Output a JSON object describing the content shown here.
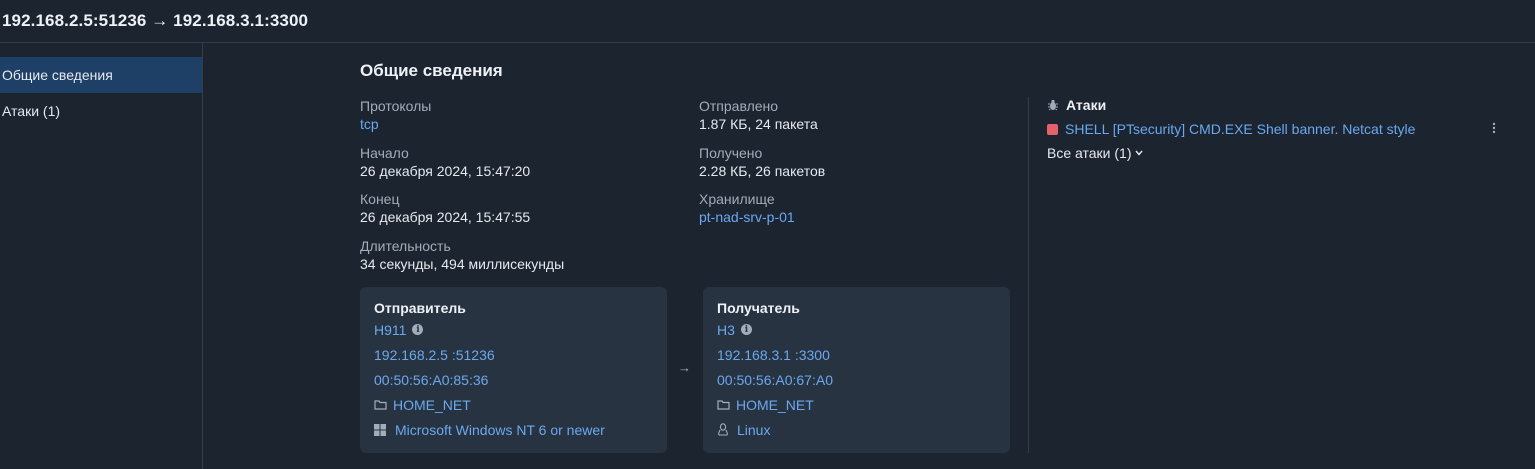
{
  "header": {
    "title": "192.168.2.5:51236 → 192.168.3.1:3300"
  },
  "sidebar": {
    "items": [
      {
        "label": "Общие сведения",
        "active": true
      },
      {
        "label": "Атаки (1)",
        "active": false
      }
    ]
  },
  "overview": {
    "title": "Общие сведения",
    "protocols_label": "Протоколы",
    "protocols_value": "tcp",
    "start_label": "Начало",
    "start_value": "26 декабря 2024, 15:47:20",
    "end_label": "Конец",
    "end_value": "26 декабря 2024, 15:47:55",
    "duration_label": "Длительность",
    "duration_value": "34 секунды, 494 миллисекунды",
    "sent_label": "Отправлено",
    "sent_value": "1.87 КБ, 24 пакета",
    "received_label": "Получено",
    "received_value": "2.28 КБ, 26 пакетов",
    "storage_label": "Хранилище",
    "storage_value": "pt-nad-srv-p-01"
  },
  "sender": {
    "title": "Отправитель",
    "host": "H911",
    "address": "192.168.2.5 :51236",
    "mac": "00:50:56:A0:85:36",
    "network": "HOME_NET",
    "os": "Microsoft Windows NT 6 or newer"
  },
  "direction_arrow": "→",
  "receiver": {
    "title": "Получатель",
    "host": "H3",
    "address": "192.168.3.1 :3300",
    "mac": "00:50:56:A0:67:A0",
    "network": "HOME_NET",
    "os": "Linux"
  },
  "attacks": {
    "title": "Атаки",
    "items": [
      {
        "name": "SHELL [PTsecurity] CMD.EXE Shell banner. Netcat style",
        "color": "#e5616b"
      }
    ],
    "all_label": "Все атаки (1)"
  },
  "icons": {
    "info": "info-icon",
    "folder": "folder-icon",
    "windows": "windows-icon",
    "linux": "linux-icon",
    "bug": "bug-icon",
    "kebab": "kebab-icon",
    "chevron": "chevron-down-icon"
  },
  "colors": {
    "accent": "#6aa8ef",
    "active_nav": "#1e3f66",
    "attack": "#e5616b",
    "card_bg": "#283341"
  }
}
